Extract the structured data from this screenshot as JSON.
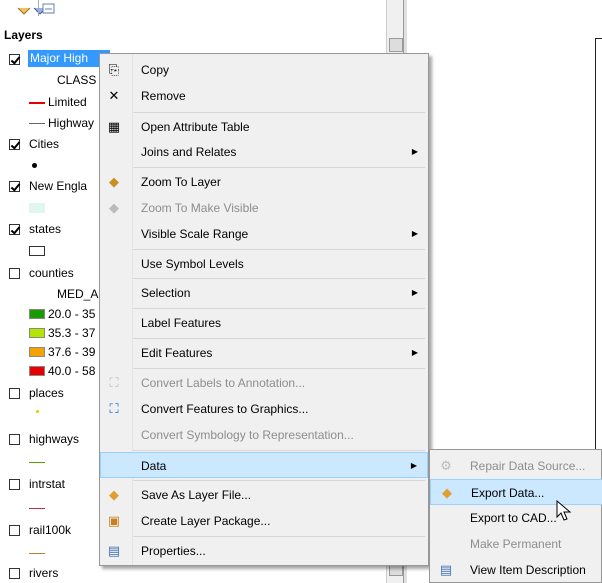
{
  "toc": {
    "title": "Layers",
    "layers": [
      {
        "name": "Major High",
        "checked": true,
        "selected": true
      },
      {
        "name": "CLASS"
      },
      {
        "name": "Limited"
      },
      {
        "name": "Highway"
      },
      {
        "name": "Cities",
        "checked": true
      },
      {
        "name": "New Engla",
        "checked": true
      },
      {
        "name": "states",
        "checked": true
      },
      {
        "name": "counties",
        "checked": false
      },
      {
        "name": "MED_A"
      },
      {
        "name": "20.0 - 35"
      },
      {
        "name": "35.3 - 37"
      },
      {
        "name": "37.6 - 39"
      },
      {
        "name": "40.0 - 58"
      },
      {
        "name": "places",
        "checked": false
      },
      {
        "name": "highways",
        "checked": false
      },
      {
        "name": "intrstat",
        "checked": false
      },
      {
        "name": "rail100k",
        "checked": false
      },
      {
        "name": "rivers",
        "checked": false
      }
    ],
    "colors": {
      "limited_line": "#e60000",
      "class1": "#1a9900",
      "class2": "#b3e600",
      "class3": "#f5a300",
      "class4": "#e60000",
      "new_england": "#dff7ef"
    }
  },
  "menu": {
    "items": [
      {
        "label": "Copy",
        "icon": "copy-icon"
      },
      {
        "label": "Remove",
        "icon": "remove-icon"
      },
      {
        "label": "Open Attribute Table",
        "icon": "table-icon"
      },
      {
        "label": "Joins and Relates",
        "submenu": true
      },
      {
        "label": "Zoom To Layer",
        "icon": "zoom-layer-icon"
      },
      {
        "label": "Zoom To Make Visible",
        "icon": "zoom-visible-icon",
        "disabled": true
      },
      {
        "label": "Visible Scale Range",
        "submenu": true
      },
      {
        "label": "Use Symbol Levels"
      },
      {
        "label": "Selection",
        "submenu": true
      },
      {
        "label": "Label Features"
      },
      {
        "label": "Edit Features",
        "submenu": true
      },
      {
        "label": "Convert Labels to Annotation...",
        "icon": "convert-labels-icon",
        "disabled": true
      },
      {
        "label": "Convert Features to Graphics...",
        "icon": "convert-features-icon"
      },
      {
        "label": "Convert Symbology to Representation...",
        "disabled": true
      },
      {
        "label": "Data",
        "submenu": true,
        "highlighted": true
      },
      {
        "label": "Save As Layer File...",
        "icon": "layer-file-icon"
      },
      {
        "label": "Create Layer Package...",
        "icon": "layer-package-icon"
      },
      {
        "label": "Properties...",
        "icon": "properties-icon"
      }
    ]
  },
  "submenu": {
    "items": [
      {
        "label": "Repair Data Source...",
        "icon": "repair-icon",
        "disabled": true
      },
      {
        "label": "Export Data...",
        "icon": "export-data-icon",
        "highlighted": true
      },
      {
        "label": "Export to CAD..."
      },
      {
        "label": "Make Permanent",
        "disabled": true
      },
      {
        "label": "View Item Description",
        "icon": "item-description-icon"
      }
    ]
  }
}
